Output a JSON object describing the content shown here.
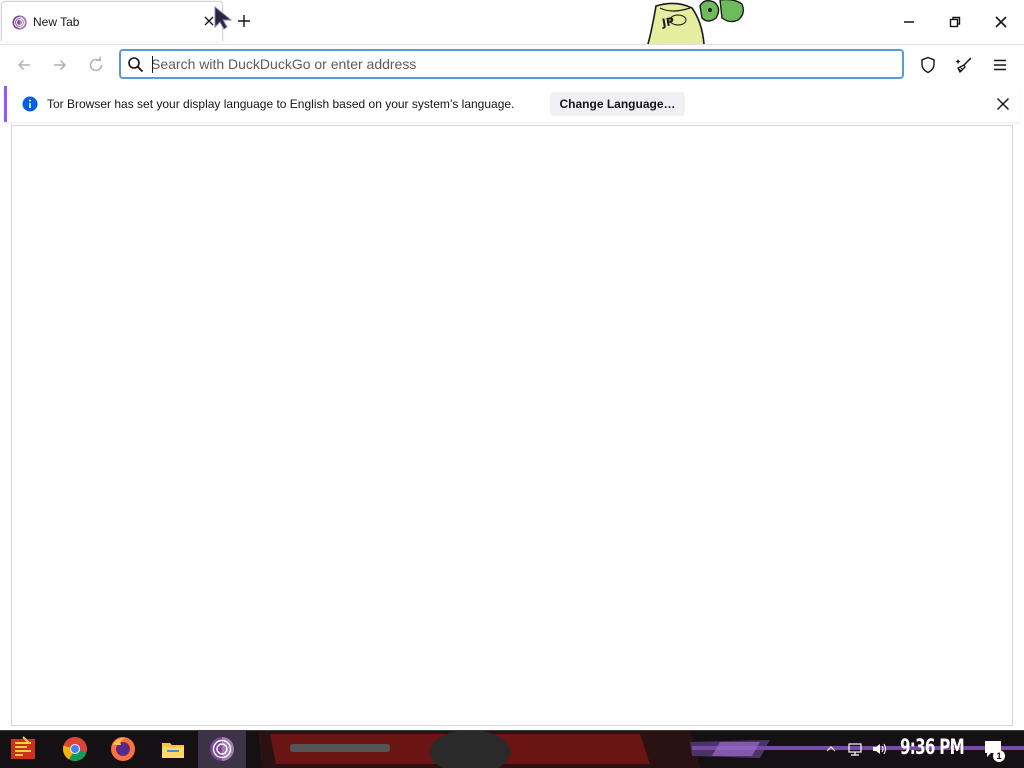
{
  "browser": {
    "tab": {
      "title": "New Tab"
    },
    "urlbar": {
      "placeholder": "Search with DuckDuckGo or enter address",
      "value": ""
    },
    "notification": {
      "message": "Tor Browser has set your display language to English based on your system’s language.",
      "button_label": "Change Language…"
    }
  },
  "taskbar": {
    "clock": "9:36 PM",
    "notification_count": "1",
    "pinned": [
      "start-icon",
      "chrome-icon",
      "firefox-icon",
      "file-explorer-icon",
      "tor-browser-icon"
    ]
  },
  "colors": {
    "accent_blue": "#0060df",
    "tor_purple": "#7d4698",
    "notification_stripe": "#9059ff",
    "urlbar_focus": "#5a9ad8"
  }
}
